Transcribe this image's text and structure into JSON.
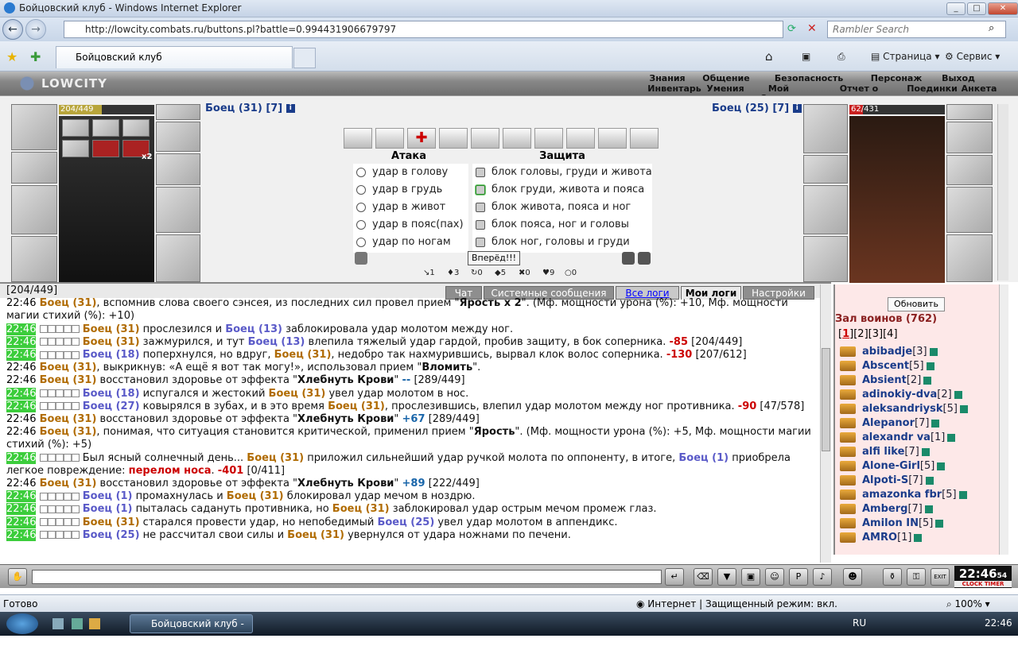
{
  "window": {
    "title": "Бойцовский клуб - Windows Internet Explorer"
  },
  "browser": {
    "url": "http://lowcity.combats.ru/buttons.pl?battle=0.994431906679797",
    "search_placeholder": "Rambler Search",
    "tab_title": "Бойцовский клуб",
    "tools": {
      "page": "Страница",
      "service": "Сервис"
    }
  },
  "game": {
    "logo": "LOWCITY",
    "menu_top": [
      "Знания",
      "Общение",
      "Безопасность",
      "Персонаж",
      "Выход"
    ],
    "menu_bottom": [
      "Инвентарь",
      "Умения",
      "Мой Скролл",
      "Отчет о переводах",
      "Поединки",
      "Анкета"
    ]
  },
  "battle": {
    "player": {
      "hp_text": "204/449",
      "hp_fraction": 0.454,
      "name": "Боец (31) [7]"
    },
    "enemy": {
      "hp_text": "62/431",
      "hp_fraction": 0.144,
      "name": "Боец (25) [7]"
    },
    "attack_title": "Атака",
    "defense_title": "Защита",
    "attack": [
      "удар в голову",
      "удар в грудь",
      "удар в живот",
      "удар в пояс(пах)",
      "удар по ногам"
    ],
    "defense": [
      "блок головы, груди и живота",
      "блок груди, живота и пояса",
      "блок живота, пояса и ног",
      "блок пояса, ног и головы",
      "блок ног, головы и груди"
    ],
    "selected_defense": 1,
    "forward": "Вперёд!!!",
    "stats": [
      "1",
      "3",
      "0",
      "5",
      "0",
      "9",
      "0"
    ],
    "x2": "x2"
  },
  "log": {
    "tabs": [
      "Чат",
      "Системные сообщения",
      "Все логи",
      "Мои логи",
      "Настройки"
    ],
    "lines": [
      {
        "t": "",
        "g": false,
        "html": "[204/449]"
      },
      {
        "t": "22:46",
        "g": false,
        "html": "<span class='n1'>Боец (31)</span>, вспомнив слова своего сэнсея, из последних сил провел прием \"<b>Ярость x 2</b>\". (Мф. мощности урона (%): +10, Мф. мощности магии стихий (%): +10)"
      },
      {
        "t": "22:46",
        "g": true,
        "b": true,
        "html": "<span class='n1'>Боец (31)</span> прослезился и <span class='n2'>Боец (13)</span> заблокировала удар молотом между ног."
      },
      {
        "t": "22:46",
        "g": true,
        "b": true,
        "html": "<span class='n1'>Боец (31)</span> зажмурился, и тут <span class='n2'>Боец (13)</span> влепила тяжелый удар гардой, пробив защиту, в бок соперника. <span class='dmg'>-85</span> [204/449]"
      },
      {
        "t": "22:46",
        "g": true,
        "b": true,
        "html": "<span class='n2'>Боец (18)</span> поперхнулся, но вдруг, <span class='n1'>Боец (31)</span>, недобро так нахмурившись, вырвал клок волос соперника. <span class='dmg'>-130</span> [207/612]"
      },
      {
        "t": "22:46",
        "g": false,
        "html": "<span class='n1'>Боец (31)</span>, выкрикнув: «А ещё я вот так могу!», использовал прием \"<b>Вломить</b>\"."
      },
      {
        "t": "22:46",
        "g": false,
        "html": "<span class='n1'>Боец (31)</span> восстановил здоровье от эффекта \"<b>Хлебнуть Крови</b>\" <span class='heal'>--</span> [289/449]"
      },
      {
        "t": "22:46",
        "g": true,
        "b": true,
        "html": "<span class='n2'>Боец (18)</span> испугался и жестокий <span class='n1'>Боец (31)</span> увел удар молотом в нос."
      },
      {
        "t": "22:46",
        "g": true,
        "b": true,
        "html": "<span class='n2'>Боец (27)</span> ковырялся в зубах, и в это время <span class='n1'>Боец (31)</span>, прослезившись, влепил удар молотом между ног противника. <span class='dmg'>-90</span> [47/578]"
      },
      {
        "t": "22:46",
        "g": false,
        "html": "<span class='n1'>Боец (31)</span> восстановил здоровье от эффекта \"<b>Хлебнуть Крови</b>\" <span class='heal'>+67</span> [289/449]"
      },
      {
        "t": "22:46",
        "g": false,
        "html": "<span class='n1'>Боец (31)</span>, понимая, что ситуация становится критической, применил прием \"<b>Ярость</b>\". (Мф. мощности урона (%): +5, Мф. мощности магии стихий (%): +5)"
      },
      {
        "t": "22:46",
        "g": true,
        "b": true,
        "html": "Был ясный солнечный день... <span class='n1'>Боец (31)</span> приложил сильнейший удар ручкой молота по оппоненту, в итоге, <span class='n2'>Боец (1)</span> приобрела легкое повреждение: <span class='dmg'>перелом носа</span>. <span class='dmg'>-401</span> [0/411]"
      },
      {
        "t": "22:46",
        "g": false,
        "html": "<span class='n1'>Боец (31)</span> восстановил здоровье от эффекта \"<b>Хлебнуть Крови</b>\" <span class='heal'>+89</span> [222/449]"
      },
      {
        "t": "22:46",
        "g": true,
        "b": true,
        "html": "<span class='n2'>Боец (1)</span> промахнулась и <span class='n1'>Боец (31)</span> блокировал удар мечом в ноздрю."
      },
      {
        "t": "22:46",
        "g": true,
        "b": true,
        "html": "<span class='n2'>Боец (1)</span> пыталась садануть противника, но <span class='n1'>Боец (31)</span> заблокировал удар острым мечом промеж глаз."
      },
      {
        "t": "22:46",
        "g": true,
        "b": true,
        "html": "<span class='n1'>Боец (31)</span> старался провести удар, но непобедимый <span class='n2'>Боец (25)</span> увел удар молотом в аппендикс."
      },
      {
        "t": "22:46",
        "g": true,
        "b": true,
        "html": "<span class='n2'>Боец (25)</span> не рассчитал свои силы и <span class='n1'>Боец (31)</span> увернулся от удара ножнами по печени."
      }
    ]
  },
  "hall": {
    "refresh": "Обновить",
    "title": "Зал воинов (762)",
    "pages": [
      "1",
      "2",
      "3",
      "4"
    ],
    "players": [
      {
        "name": "abibadje",
        "lvl": "[3]"
      },
      {
        "name": "Abscent",
        "lvl": "[5]"
      },
      {
        "name": "Absient",
        "lvl": "[2]"
      },
      {
        "name": "adinokiy-dva",
        "lvl": "[2]"
      },
      {
        "name": "aleksandriysk",
        "lvl": "[5]"
      },
      {
        "name": "Alepanor",
        "lvl": "[7]"
      },
      {
        "name": "alexandr va",
        "lvl": "[1]"
      },
      {
        "name": "alfi like",
        "lvl": "[7]"
      },
      {
        "name": "Alone-Girl",
        "lvl": "[5]"
      },
      {
        "name": "Alpoti-S",
        "lvl": "[7]"
      },
      {
        "name": "amazonka fbr",
        "lvl": "[5]"
      },
      {
        "name": "Amberg",
        "lvl": "[7]"
      },
      {
        "name": "Amilon IN",
        "lvl": "[5]"
      },
      {
        "name": "AMRO",
        "lvl": "[1]"
      }
    ]
  },
  "chat": {
    "clock": "22:46",
    "clock_sec": "54",
    "clock_labels": "CLOCK TIMER",
    "exit": "EXIT"
  },
  "status": {
    "left": "Готово",
    "zone": "Интернет | Защищенный режим: вкл.",
    "zoom": "100%"
  },
  "taskbar": {
    "task": "Бойцовский клуб - ...",
    "lang": "RU",
    "time": "22:46"
  }
}
